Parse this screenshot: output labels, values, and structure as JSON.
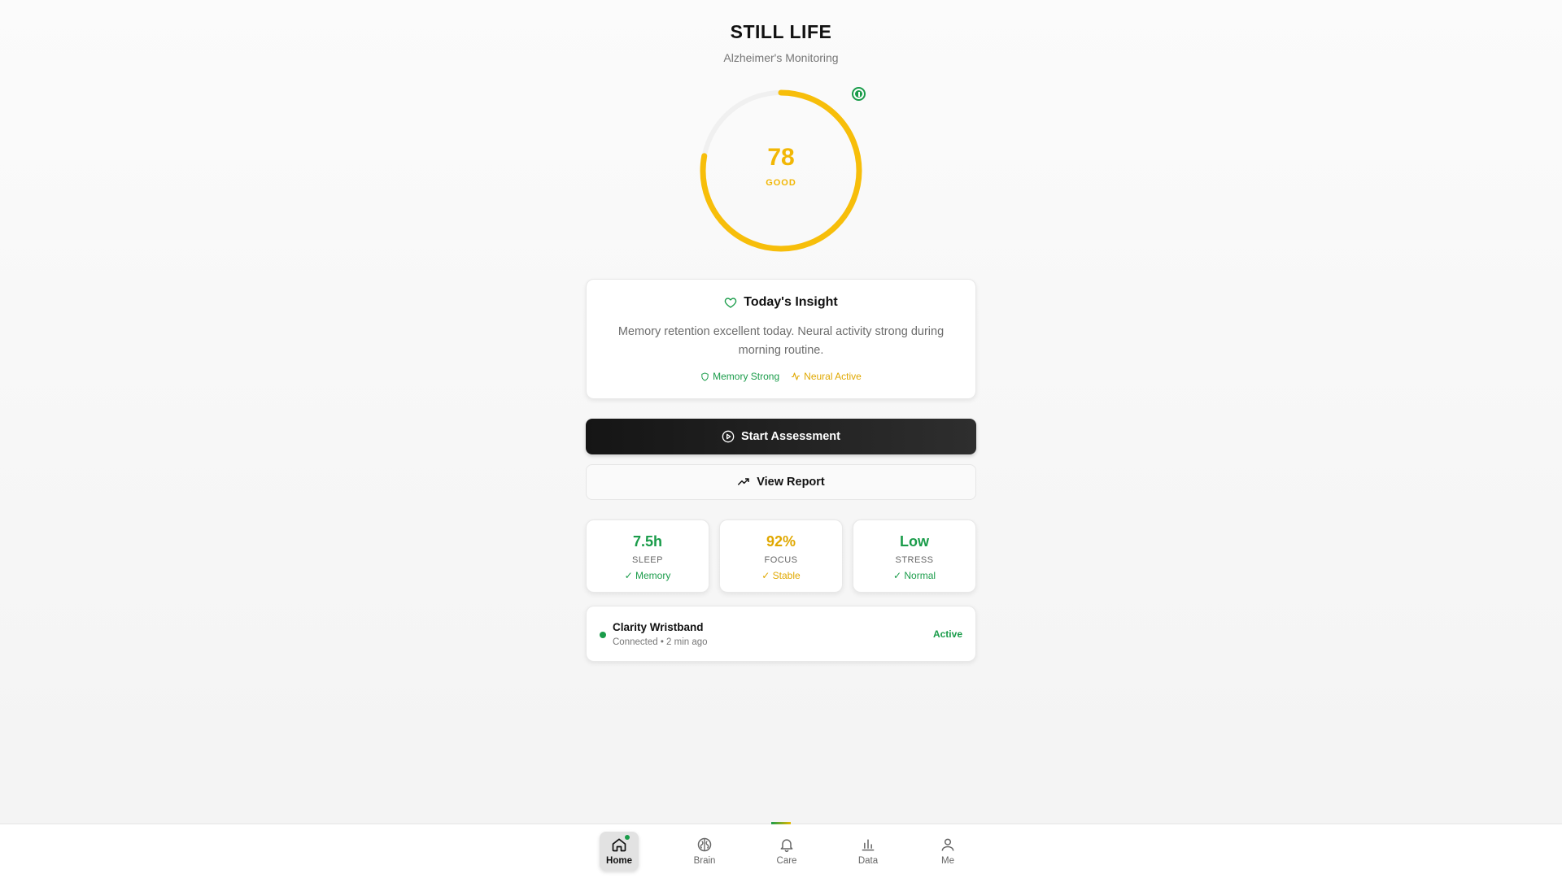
{
  "app": {
    "title": "STILL LIFE",
    "subtitle": "Alzheimer's Monitoring"
  },
  "score": {
    "value": "78",
    "label": "GOOD",
    "fraction": 0.78,
    "color": "#f2b705"
  },
  "insight": {
    "title": "Today's Insight",
    "text": "Memory retention excellent today. Neural activity strong during morning routine.",
    "tags": [
      {
        "label": "Memory Strong",
        "icon": "shield-icon",
        "color": "#1a9c4a"
      },
      {
        "label": "Neural Active",
        "icon": "activity-icon",
        "color": "#e0a800"
      }
    ]
  },
  "actions": {
    "primary": {
      "label": "Start Assessment",
      "icon": "play-circle-icon"
    },
    "secondary": {
      "label": "View Report",
      "icon": "trending-up-icon"
    }
  },
  "stats": [
    {
      "value": "7.5h",
      "label": "SLEEP",
      "note": "✓ Memory",
      "color": "#1a9c4a"
    },
    {
      "value": "92%",
      "label": "FOCUS",
      "note": "✓ Stable",
      "color": "#e0a800"
    },
    {
      "value": "Low",
      "label": "STRESS",
      "note": "✓ Normal",
      "color": "#1a9c4a"
    }
  ],
  "device": {
    "name": "Clarity Wristband",
    "sub": "Connected • 2 min ago",
    "status": "Active"
  },
  "nav": {
    "items": [
      {
        "label": "Home",
        "icon": "home-icon",
        "active": true
      },
      {
        "label": "Brain",
        "icon": "brain-icon"
      },
      {
        "label": "Care",
        "icon": "bell-icon"
      },
      {
        "label": "Data",
        "icon": "bar-chart-icon"
      },
      {
        "label": "Me",
        "icon": "user-icon"
      }
    ]
  }
}
